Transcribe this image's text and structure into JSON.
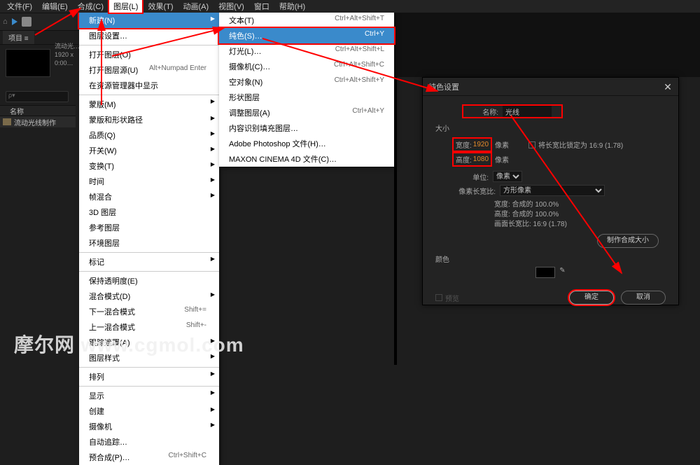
{
  "menubar": {
    "file": "文件(F)",
    "edit": "编辑(E)",
    "comp": "合成(C)",
    "layer": "图层(L)",
    "effect": "效果(T)",
    "animation": "动画(A)",
    "view": "视图(V)",
    "window": "窗口",
    "help": "帮助(H)"
  },
  "project": {
    "tab": "项目 ≡",
    "meta_name": "流动光…",
    "meta_res": "1920 x",
    "meta_info": "0:00…",
    "search_placeholder": "ρ▾",
    "col_name": "名称",
    "item_name": "流动光线制作"
  },
  "menu1": [
    {
      "label": "新建(N)",
      "hi": true,
      "arrow": true,
      "redbox": true
    },
    {
      "label": "图层设置…",
      "shortcut": "",
      "sep": false
    },
    {
      "label": "打开图层(O)",
      "sep": true
    },
    {
      "label": "打开图层源(U)",
      "shortcut": "Alt+Numpad Enter"
    },
    {
      "label": "在资源管理器中显示"
    },
    {
      "label": "蒙版(M)",
      "arrow": true,
      "sep": true
    },
    {
      "label": "蒙版和形状路径",
      "arrow": true
    },
    {
      "label": "品质(Q)",
      "arrow": true
    },
    {
      "label": "开关(W)",
      "arrow": true
    },
    {
      "label": "变换(T)",
      "arrow": true
    },
    {
      "label": "时间",
      "arrow": true
    },
    {
      "label": "帧混合",
      "arrow": true
    },
    {
      "label": "3D 图层"
    },
    {
      "label": "参考图层"
    },
    {
      "label": "环境图层"
    },
    {
      "label": "标记",
      "arrow": true,
      "sep": true
    },
    {
      "label": "保持透明度(E)",
      "sep": true
    },
    {
      "label": "混合模式(D)",
      "arrow": true
    },
    {
      "label": "下一混合模式",
      "shortcut": "Shift+="
    },
    {
      "label": "上一混合模式",
      "shortcut": "Shift+-"
    },
    {
      "label": "跟踪遮罩(A)",
      "arrow": true
    },
    {
      "label": "图层样式",
      "arrow": true
    },
    {
      "label": "排列",
      "arrow": true,
      "sep": true
    },
    {
      "label": "显示",
      "arrow": true,
      "sep": true
    },
    {
      "label": "创建",
      "arrow": true
    },
    {
      "label": "摄像机",
      "arrow": true
    },
    {
      "label": "自动追踪…"
    },
    {
      "label": "预合成(P)…",
      "shortcut": "Ctrl+Shift+C"
    }
  ],
  "menu2": [
    {
      "label": "文本(T)",
      "shortcut": "Ctrl+Alt+Shift+T"
    },
    {
      "label": "纯色(S)…",
      "shortcut": "Ctrl+Y",
      "hi": true,
      "redbox": true
    },
    {
      "label": "灯光(L)…",
      "shortcut": "Ctrl+Alt+Shift+L"
    },
    {
      "label": "摄像机(C)…",
      "shortcut": "Ctrl+Alt+Shift+C"
    },
    {
      "label": "空对象(N)",
      "shortcut": "Ctrl+Alt+Shift+Y"
    },
    {
      "label": "形状图层"
    },
    {
      "label": "调整图层(A)",
      "shortcut": "Ctrl+Alt+Y"
    },
    {
      "label": "内容识别填充图层…"
    },
    {
      "label": "Adobe Photoshop 文件(H)…"
    },
    {
      "label": "MAXON CINEMA 4D 文件(C)…"
    }
  ],
  "dialog": {
    "title": "纯色设置",
    "name_label": "名称:",
    "name_value": "光线",
    "size_heading": "大小",
    "width_label": "宽度:",
    "width_value": "1920",
    "width_suffix": "像素",
    "height_label": "高度:",
    "height_value": "1080",
    "height_suffix": "像素",
    "lock_label": "将长宽比锁定为 16:9 (1.78)",
    "unit_label": "单位:",
    "unit_value": "像素",
    "par_label": "像素长宽比:",
    "par_value": "方形像素",
    "info_w": "宽度: 合成的 100.0%",
    "info_h": "高度: 合成的 100.0%",
    "info_par": "画面长宽比: 16:9 (1.78)",
    "make_comp_btn": "制作合成大小",
    "color_heading": "颜色",
    "preview_check": "预览",
    "ok": "确定",
    "cancel": "取消"
  },
  "watermark": "摩尔网 www.cgmol.com"
}
